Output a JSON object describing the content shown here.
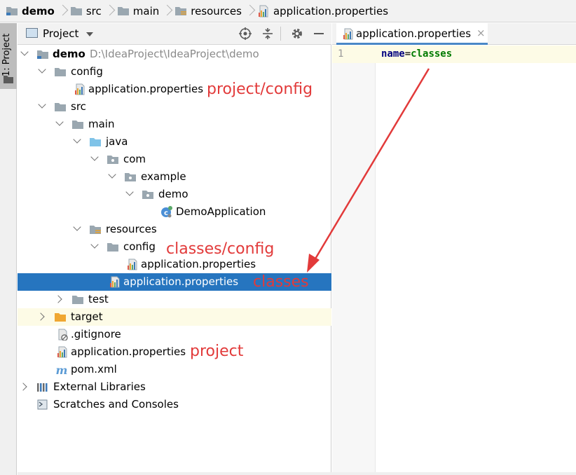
{
  "breadcrumb": {
    "items": [
      "demo",
      "src",
      "main",
      "resources",
      "application.properties"
    ]
  },
  "sidestrip": {
    "tab_label": "1: Project"
  },
  "project_panel": {
    "title": "Project"
  },
  "tree": {
    "root_name": "demo",
    "root_path": "D:\\IdeaProject\\IdeaProject\\demo",
    "config": "config",
    "config_props": "application.properties",
    "src": "src",
    "main": "main",
    "java": "java",
    "com": "com",
    "example": "example",
    "demo_pkg": "demo",
    "demo_app": "DemoApplication",
    "resources": "resources",
    "res_config": "config",
    "res_config_props": "application.properties",
    "res_props": "application.properties",
    "test": "test",
    "target": "target",
    "gitignore": ".gitignore",
    "root_props": "application.properties",
    "pom": "pom.xml",
    "ext_libs": "External Libraries",
    "scratches": "Scratches and Consoles"
  },
  "annotations": {
    "project_config": "project/config",
    "classes_config": "classes/config",
    "classes": "classes",
    "project": "project"
  },
  "editor": {
    "tab_label": "application.properties",
    "tab_close": "×",
    "line_number": "1",
    "code_key": "name",
    "code_eq": "=",
    "code_value": "classes"
  },
  "colors": {
    "selection": "#2675bf",
    "annotation": "#e23a3a",
    "folder": "#9aa7b0",
    "source_folder": "#7fc3e8",
    "excluded_folder": "#f0a732"
  }
}
